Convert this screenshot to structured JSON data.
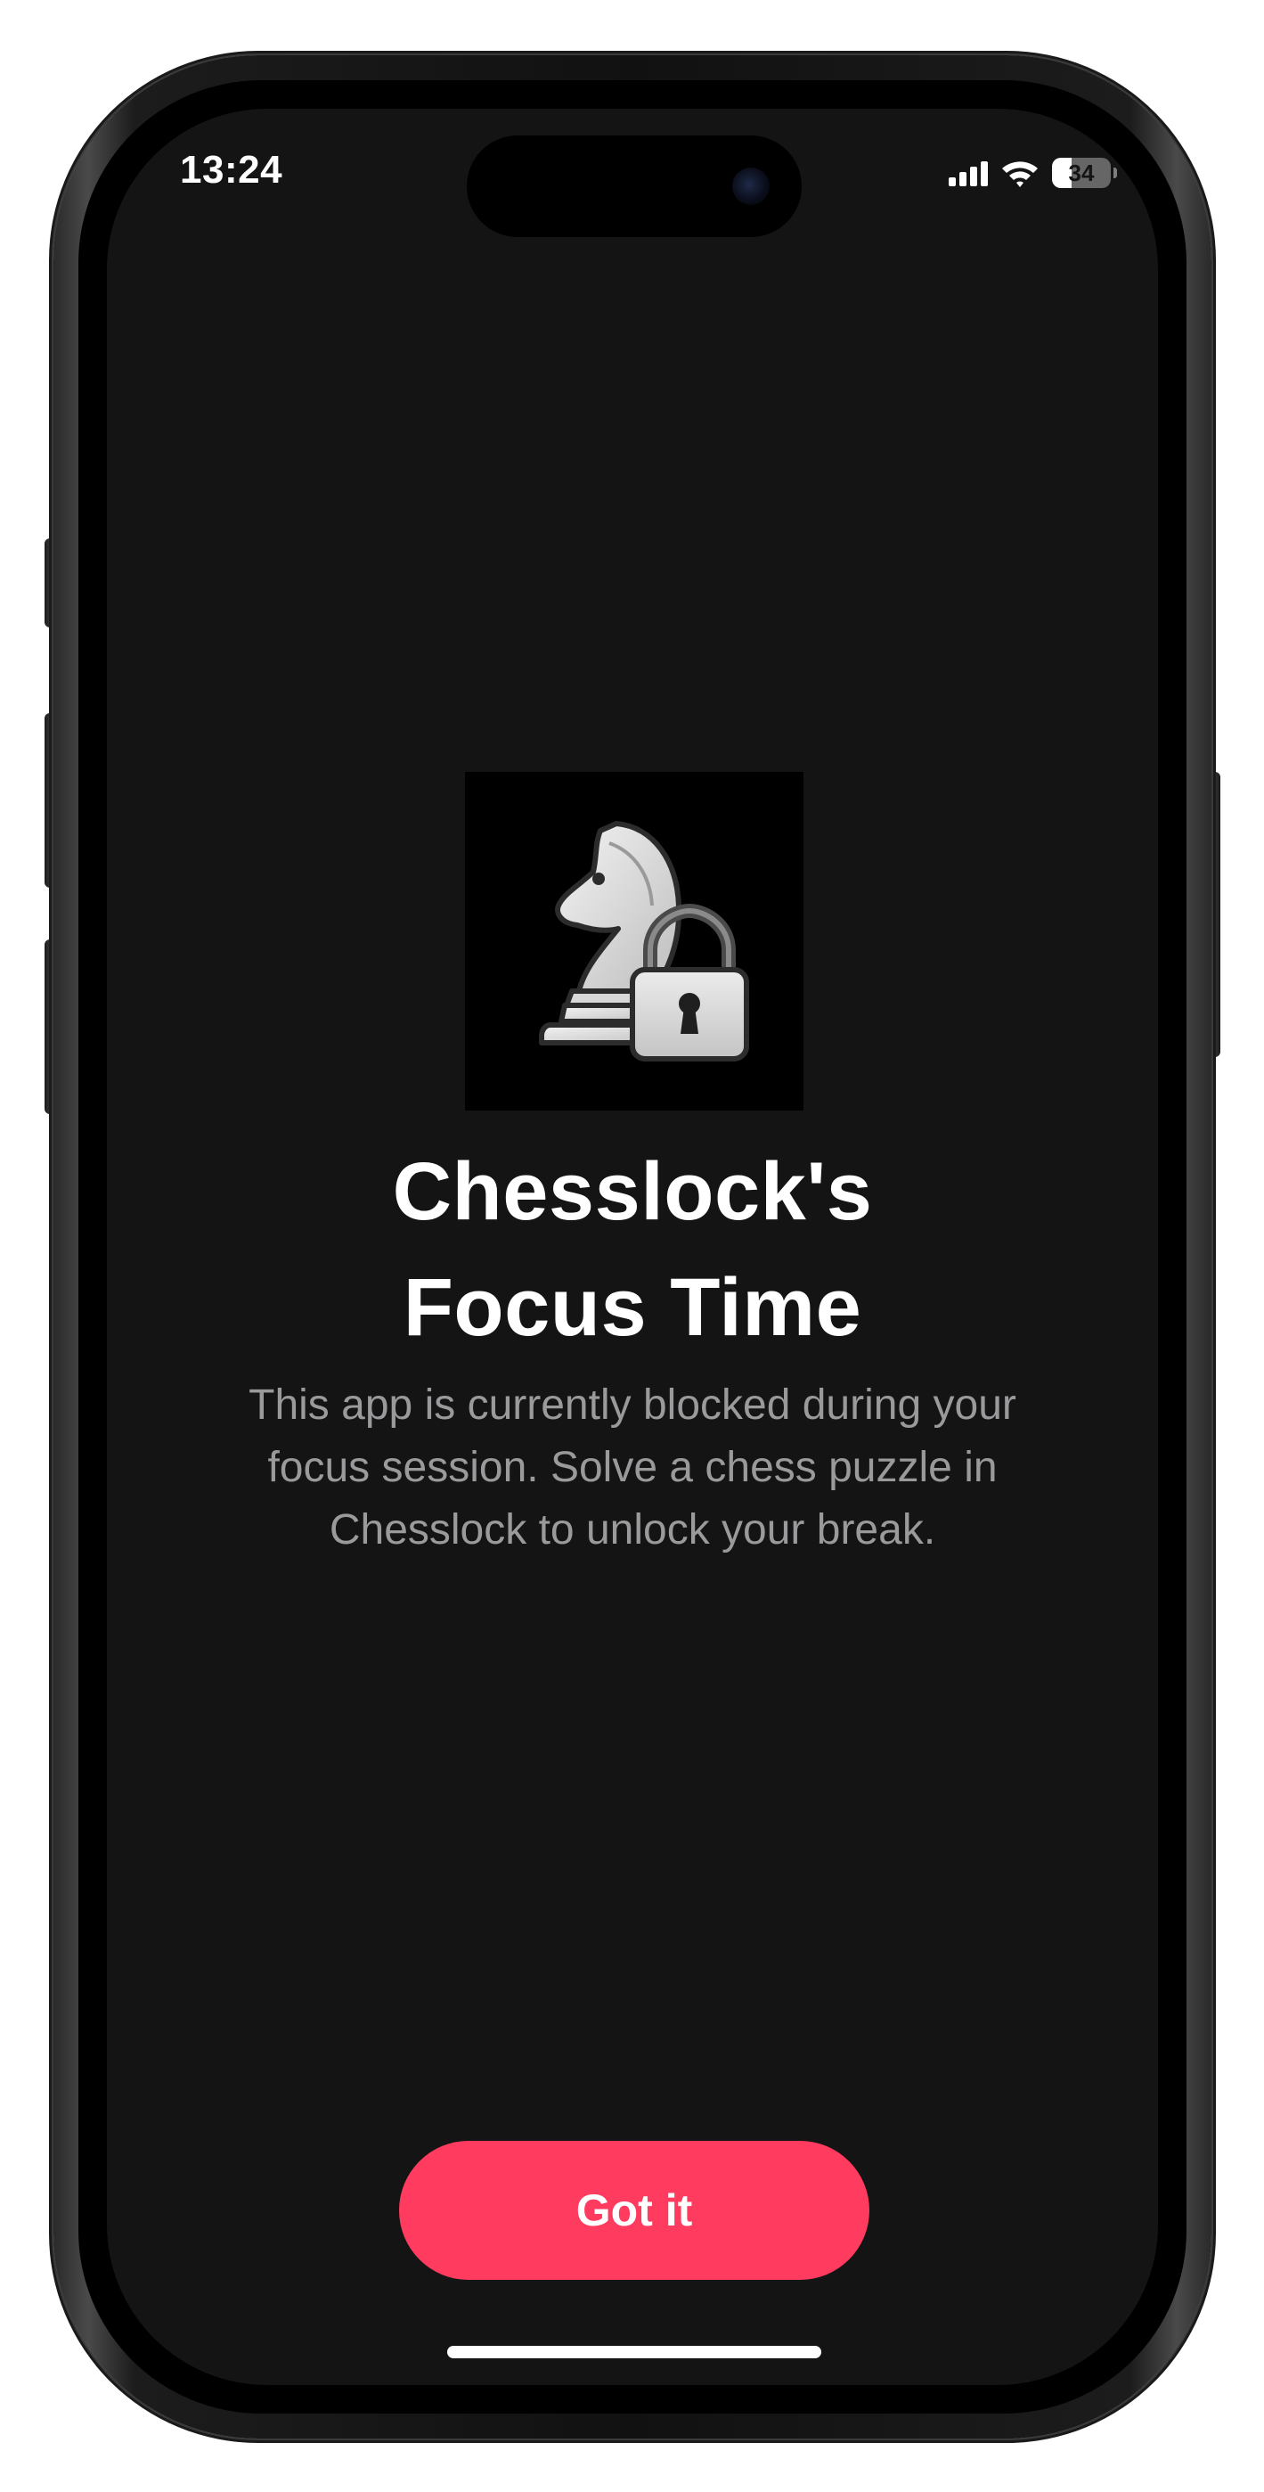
{
  "status_bar": {
    "time": "13:24",
    "battery_level": "34",
    "battery_fraction": 0.34,
    "icons": [
      "signal-icon",
      "wifi-icon",
      "battery-icon"
    ]
  },
  "app_logo": {
    "icon": "chess-knight-lock-icon"
  },
  "blocker": {
    "title_line1": "Chesslock's",
    "title_line2": "Focus Time",
    "description": "This app is currently blocked during your focus session. Solve a chess puzzle in Chesslock to unlock your break.",
    "button_label": "Got it"
  },
  "colors": {
    "background": "#141414",
    "accent": "#ff3b5f",
    "secondary_text": "#9a9a9c"
  }
}
